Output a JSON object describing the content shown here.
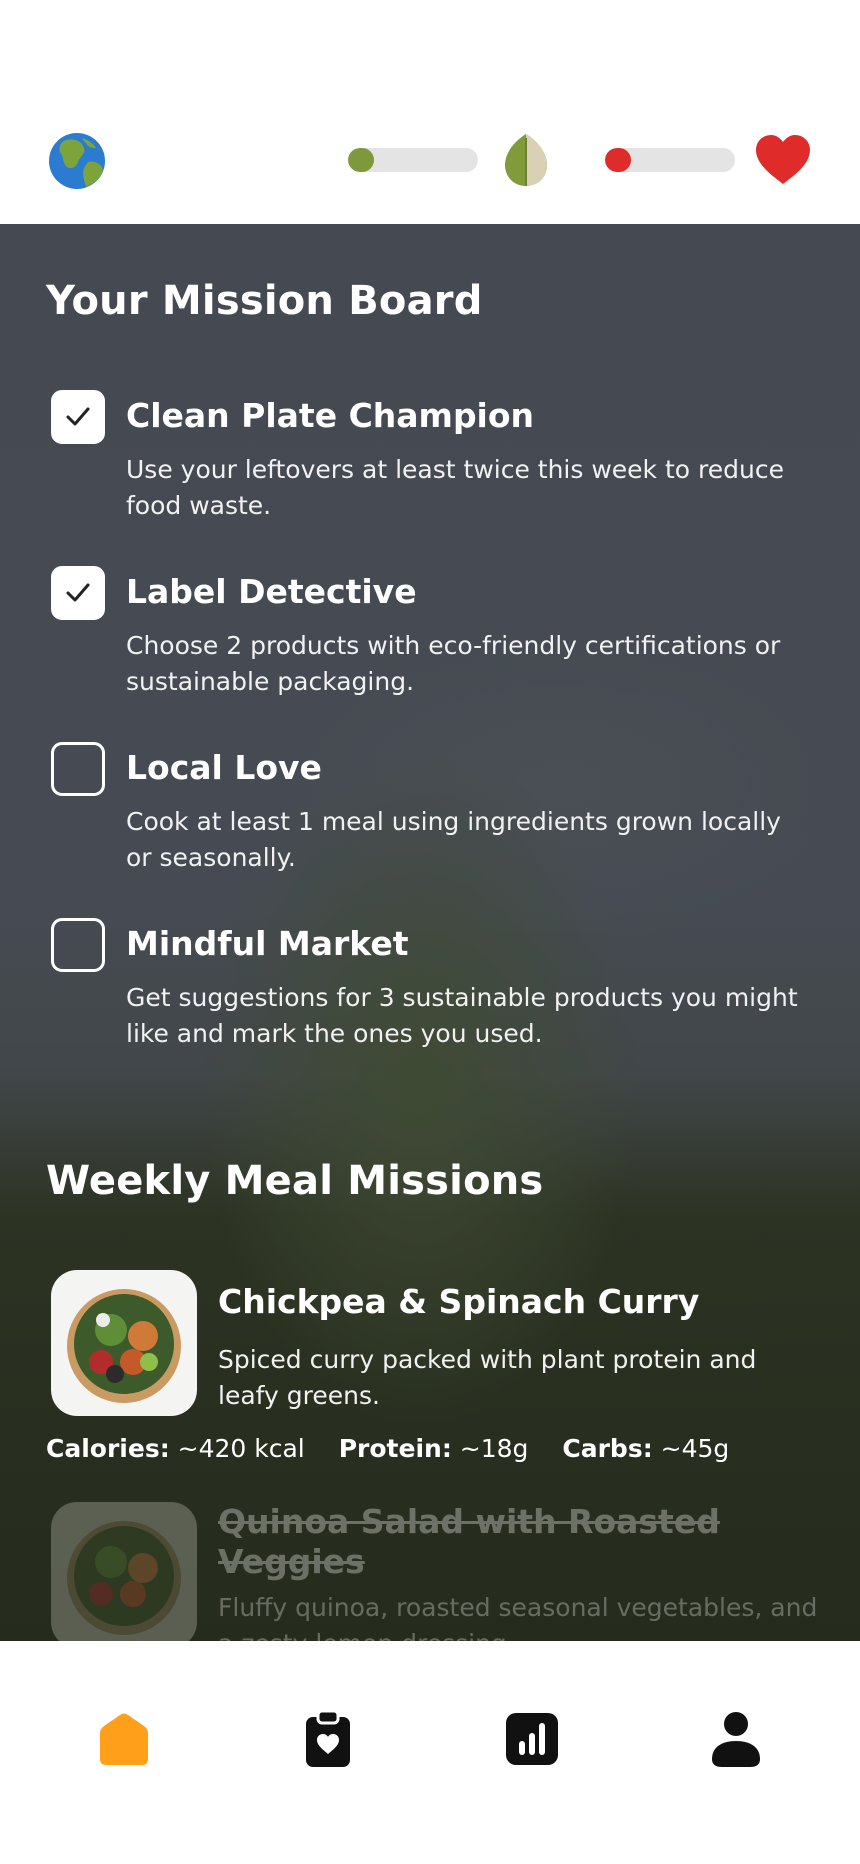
{
  "header": {
    "eco_progress": 0.2,
    "health_progress": 0.2,
    "colors": {
      "eco": "#7c9a3c",
      "health": "#e02b2b",
      "track": "#e4e4e4"
    },
    "icons": [
      "globe-icon",
      "leaf-icon",
      "heart-icon"
    ]
  },
  "mission_board": {
    "title": "Your Mission Board",
    "missions": [
      {
        "title": "Clean Plate Champion",
        "description": "Use your leftovers at least twice this week to reduce food waste.",
        "checked": true
      },
      {
        "title": "Label Detective",
        "description": "Choose 2 products with eco-friendly certifications or sustainable packaging.",
        "checked": true
      },
      {
        "title": "Local Love",
        "description": "Cook at least 1 meal using ingredients grown locally or seasonally.",
        "checked": false
      },
      {
        "title": "Mindful Market",
        "description": "Get suggestions for 3 sustainable products you might like and mark the ones you used.",
        "checked": false
      }
    ]
  },
  "meal_missions": {
    "title": "Weekly Meal Missions",
    "meals": [
      {
        "name": "Chickpea & Spinach Curry",
        "description": "Spiced curry packed with plant protein and leafy greens.",
        "calories_label": "Calories:",
        "calories": "~420 kcal",
        "protein_label": "Protein:",
        "protein": "~18g",
        "carbs_label": "Carbs:",
        "carbs": "~45g",
        "completed": false
      },
      {
        "name": "Quinoa Salad with Roasted Veggies",
        "description": "Fluffy quinoa, roasted seasonal vegetables, and a zesty lemon dressing.",
        "completed": true
      }
    ]
  },
  "bottom_nav": {
    "items": [
      "home-icon",
      "clipboard-heart-icon",
      "stats-icon",
      "profile-icon"
    ],
    "active": "home-icon",
    "active_color": "#ff9f1a"
  }
}
